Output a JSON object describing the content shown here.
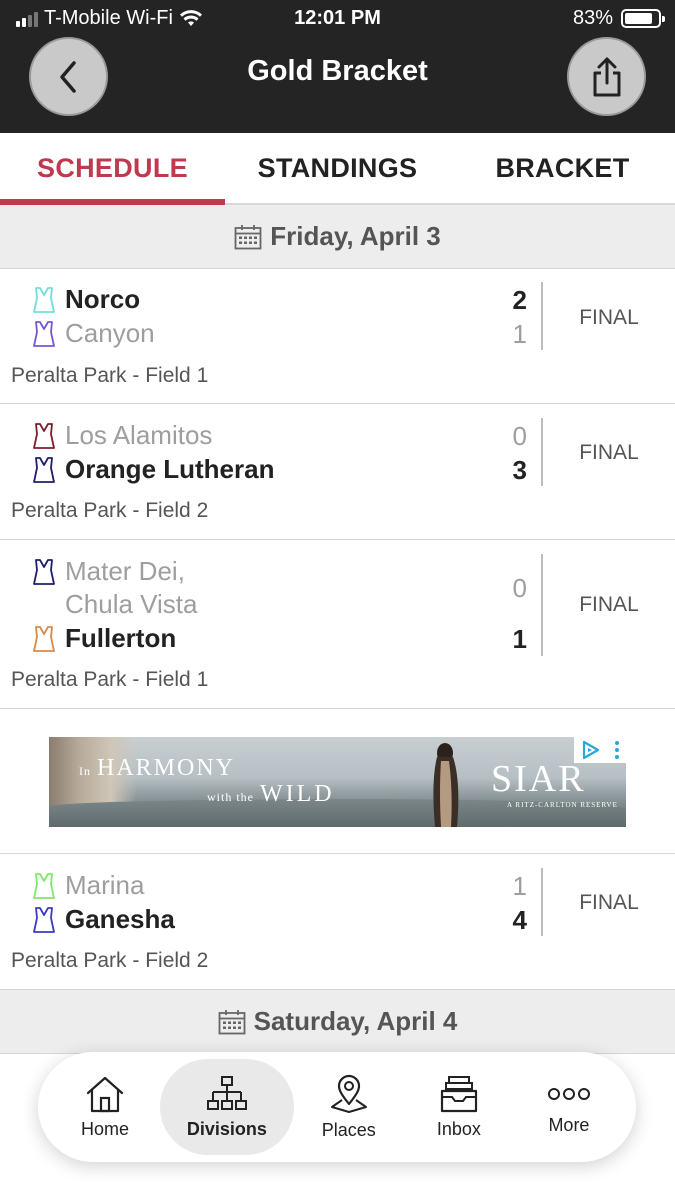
{
  "status_bar": {
    "carrier": "T-Mobile Wi-Fi",
    "time": "12:01 PM",
    "battery": "83%",
    "battery_level": 0.83
  },
  "header": {
    "title": "Gold Bracket",
    "back_icon": "chevron-left-icon",
    "share_icon": "share-icon"
  },
  "tabs": [
    {
      "label": "SCHEDULE",
      "active": true
    },
    {
      "label": "STANDINGS",
      "active": false
    },
    {
      "label": "BRACKET",
      "active": false
    }
  ],
  "days": [
    {
      "label": "Friday, April 3"
    },
    {
      "label": "Saturday, April 4"
    }
  ],
  "games": [
    {
      "teams": [
        {
          "name": "Norco",
          "score": "2",
          "winner": true,
          "jersey_color": "#6fe0d9"
        },
        {
          "name": "Canyon",
          "score": "1",
          "winner": false,
          "jersey_color": "#7a55d6"
        }
      ],
      "status": "FINAL",
      "location": "Peralta Park - Field 1"
    },
    {
      "teams": [
        {
          "name": "Los Alamitos",
          "score": "0",
          "winner": false,
          "jersey_color": "#7a1f2a"
        },
        {
          "name": "Orange Lutheran",
          "score": "3",
          "winner": true,
          "jersey_color": "#1f1f6e"
        }
      ],
      "status": "FINAL",
      "location": "Peralta Park - Field 2"
    },
    {
      "teams": [
        {
          "name_line1": "Mater Dei,",
          "name_line2": "Chula Vista",
          "score": "0",
          "winner": false,
          "jersey_color": "#1f1f6e"
        },
        {
          "name": "Fullerton",
          "score": "1",
          "winner": true,
          "jersey_color": "#d98a4a"
        }
      ],
      "status": "FINAL",
      "location": "Peralta Park - Field 1"
    },
    {
      "teams": [
        {
          "name": "Marina",
          "score": "1",
          "winner": false,
          "jersey_color": "#7ee86a"
        },
        {
          "name": "Ganesha",
          "score": "4",
          "winner": true,
          "jersey_color": "#3b3bc0"
        }
      ],
      "status": "FINAL",
      "location": "Peralta Park - Field 2"
    }
  ],
  "ad": {
    "line1_small": "In",
    "line1": "HARMONY",
    "line2_small": "with the",
    "line2": "WILD",
    "brand": "SIAR",
    "brand_sub": "A RITZ-CARLTON RESERVE"
  },
  "bottom_nav": [
    {
      "label": "Home",
      "icon": "home-icon",
      "active": false
    },
    {
      "label": "Divisions",
      "icon": "divisions-icon",
      "active": true
    },
    {
      "label": "Places",
      "icon": "places-icon",
      "active": false
    },
    {
      "label": "Inbox",
      "icon": "inbox-icon",
      "active": false
    },
    {
      "label": "More",
      "icon": "more-icon",
      "active": false
    }
  ],
  "colors": {
    "accent": "#c0394e",
    "header_bg": "#242424"
  }
}
